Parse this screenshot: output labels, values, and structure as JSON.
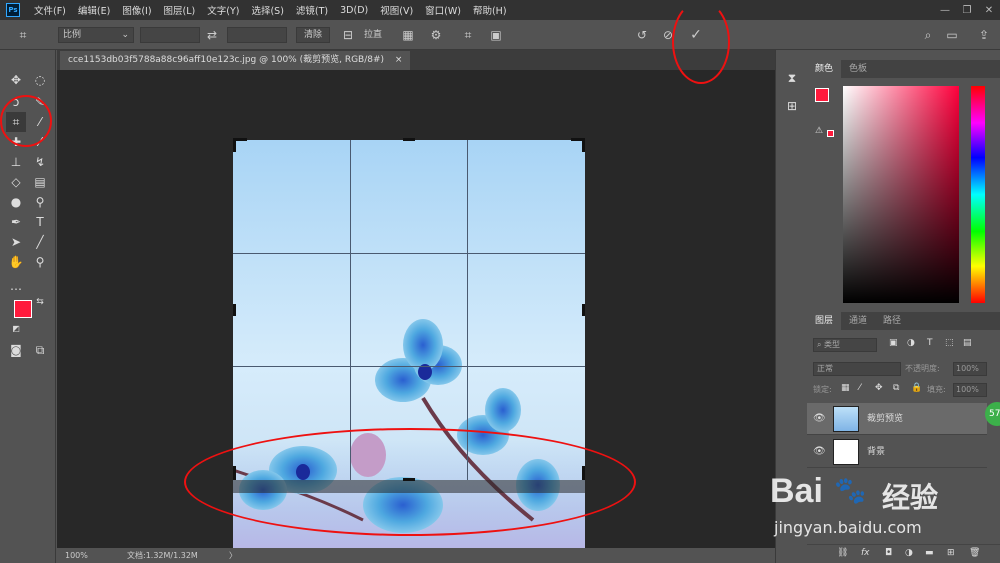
{
  "app": {
    "logo": "Ps"
  },
  "menu": [
    "文件(F)",
    "编辑(E)",
    "图像(I)",
    "图层(L)",
    "文字(Y)",
    "选择(S)",
    "滤镜(T)",
    "3D(D)",
    "视图(V)",
    "窗口(W)",
    "帮助(H)"
  ],
  "window_controls": [
    "—",
    "❐",
    "✕"
  ],
  "options": {
    "ratio_label": "比例",
    "clear_label": "清除",
    "straighten_label": "拉直"
  },
  "document": {
    "tab_title": "cce1153db03f5788a88c96aff10e123c.jpg @ 100% (裁剪预览, RGB/8#)",
    "close": "×"
  },
  "status": {
    "zoom": "100%",
    "doc_info": "文档:1.32M/1.32M",
    "arrow": "〉"
  },
  "color_panel": {
    "tabs": [
      "颜色",
      "色板"
    ],
    "fg": "#ff1a3c",
    "bg": "#ffffff"
  },
  "layers_panel": {
    "tabs": [
      "图层",
      "通道",
      "路径"
    ],
    "filter_placeholder": "类型",
    "blend_mode": "正常",
    "opacity_label": "不透明度:",
    "opacity_value": "100%",
    "lock_label": "锁定:",
    "fill_label": "填充:",
    "fill_value": "100%",
    "layers": [
      {
        "name": "裁剪预览",
        "selected": true
      },
      {
        "name": "背景",
        "selected": false
      }
    ],
    "badge": "57"
  },
  "watermark": {
    "brand": "Bai",
    "cn": "经验",
    "url": "jingyan.baidu.com"
  }
}
